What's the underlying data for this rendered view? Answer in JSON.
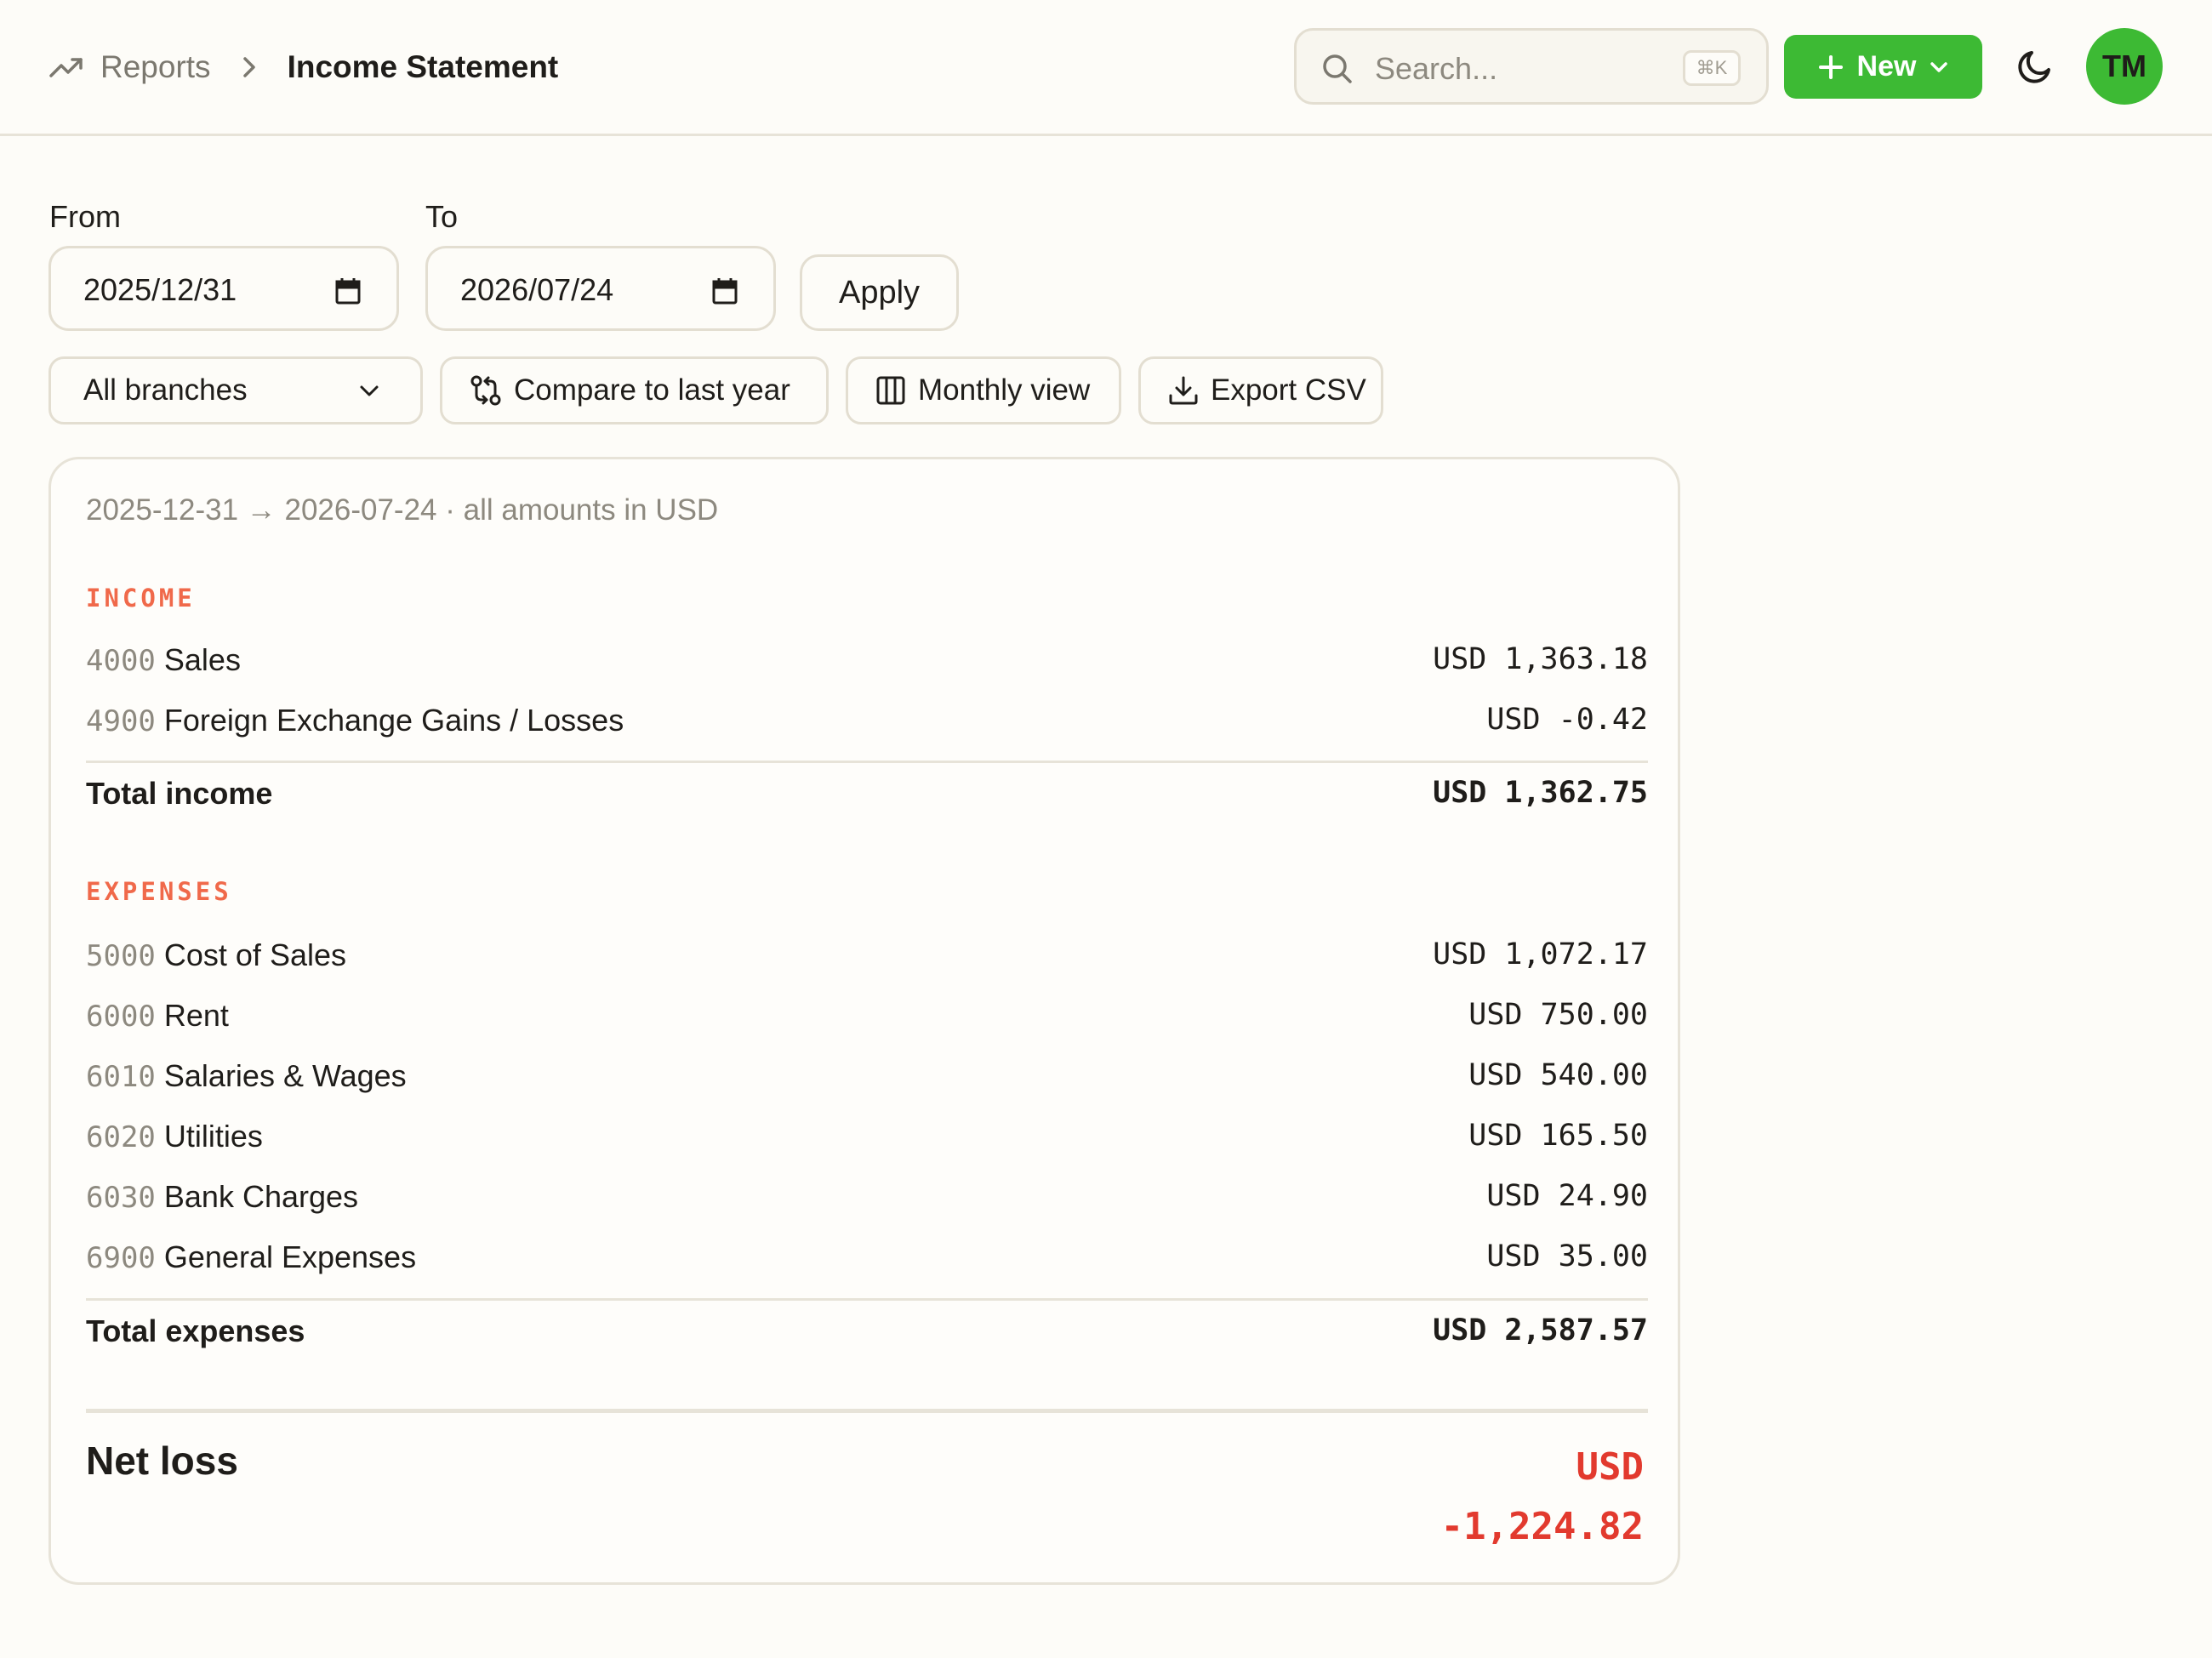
{
  "header": {
    "breadcrumb_root": "Reports",
    "breadcrumb_current": "Income Statement",
    "search_placeholder": "Search...",
    "search_shortcut": "⌘K",
    "new_label": "New",
    "avatar_initials": "TM"
  },
  "filters": {
    "from_label": "From",
    "from_value": "2025/12/31",
    "to_label": "To",
    "to_value": "2026/07/24",
    "apply_label": "Apply",
    "branch_select": "All branches",
    "compare_label": "Compare to last year",
    "monthly_label": "Monthly view",
    "export_label": "Export CSV"
  },
  "report": {
    "period": "2025-12-31 → 2026-07-24 · all amounts in USD",
    "income": {
      "heading": "INCOME",
      "rows": [
        {
          "code": "4000",
          "name": "Sales",
          "amount": "USD 1,363.18"
        },
        {
          "code": "4900",
          "name": "Foreign Exchange Gains / Losses",
          "amount": "USD -0.42"
        }
      ],
      "total_label": "Total income",
      "total_amount": "USD 1,362.75"
    },
    "expenses": {
      "heading": "EXPENSES",
      "rows": [
        {
          "code": "5000",
          "name": "Cost of Sales",
          "amount": "USD 1,072.17"
        },
        {
          "code": "6000",
          "name": "Rent",
          "amount": "USD 750.00"
        },
        {
          "code": "6010",
          "name": "Salaries & Wages",
          "amount": "USD 540.00"
        },
        {
          "code": "6020",
          "name": "Utilities",
          "amount": "USD 165.50"
        },
        {
          "code": "6030",
          "name": "Bank Charges",
          "amount": "USD 24.90"
        },
        {
          "code": "6900",
          "name": "General Expenses",
          "amount": "USD 35.00"
        }
      ],
      "total_label": "Total expenses",
      "total_amount": "USD 2,587.57"
    },
    "net_label": "Net loss",
    "net_currency": "USD",
    "net_amount": "-1,224.82"
  },
  "colors": {
    "accent_green": "#3dba34",
    "section_heading": "#f0694a",
    "net_loss_red": "#e23a2e"
  }
}
